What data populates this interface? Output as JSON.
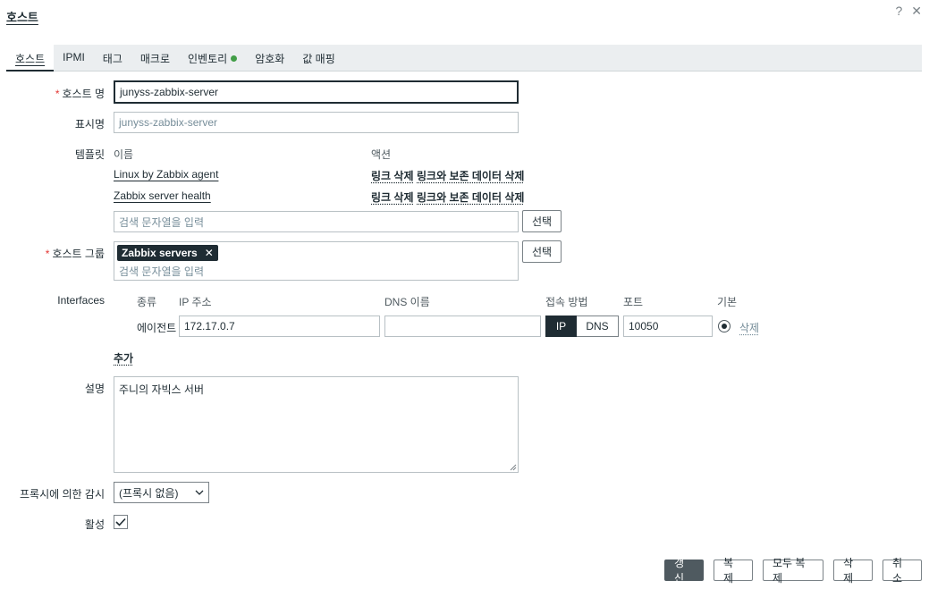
{
  "header": {
    "title": "호스트",
    "help_icon": "?",
    "close_icon": "✕"
  },
  "tabs": [
    {
      "label": "호스트"
    },
    {
      "label": "IPMI"
    },
    {
      "label": "태그"
    },
    {
      "label": "매크로"
    },
    {
      "label": "인벤토리"
    },
    {
      "label": "암호화"
    },
    {
      "label": "값 매핑"
    }
  ],
  "form": {
    "host_name": {
      "label": "호스트 명",
      "value": "junyss-zabbix-server"
    },
    "visible_name": {
      "label": "표시명",
      "placeholder": "junyss-zabbix-server"
    },
    "templates": {
      "label": "템플릿",
      "col_name": "이름",
      "col_action": "액션",
      "rows": [
        {
          "name": "Linux by Zabbix agent",
          "unlink": "링크 삭제",
          "unlink_clear": "링크와 보존 데이터 삭제"
        },
        {
          "name": "Zabbix server health",
          "unlink": "링크 삭제",
          "unlink_clear": "링크와 보존 데이터 삭제"
        }
      ],
      "search_placeholder": "검색 문자열을 입력",
      "select_button": "선택"
    },
    "host_groups": {
      "label": "호스트 그룹",
      "tag": "Zabbix servers",
      "tag_remove": "✕",
      "search_placeholder": "검색 문자열을 입력",
      "select_button": "선택"
    },
    "interfaces": {
      "label": "Interfaces",
      "headers": {
        "type": "종류",
        "ip": "IP 주소",
        "dns": "DNS 이름",
        "connect": "접속 방법",
        "port": "포트",
        "default": "기본"
      },
      "row": {
        "type": "에이전트",
        "ip": "172.17.0.7",
        "dns": "",
        "connect_ip": "IP",
        "connect_dns": "DNS",
        "port": "10050",
        "remove": "삭제"
      },
      "add": "추가"
    },
    "description": {
      "label": "설명",
      "value": "주니의 자빅스 서버"
    },
    "proxy": {
      "label": "프록시에 의한 감시",
      "value": "(프록시 없음)"
    },
    "enabled": {
      "label": "활성",
      "checked": true
    }
  },
  "footer": {
    "update": "갱신",
    "clone": "복제",
    "full_clone": "모두 복제",
    "delete": "삭제",
    "cancel": "취소"
  },
  "colors": {
    "accent": "#1f2c33",
    "required": "#e33734",
    "inventory_dot": "#429e47",
    "primary_button": "#4f5a60"
  }
}
